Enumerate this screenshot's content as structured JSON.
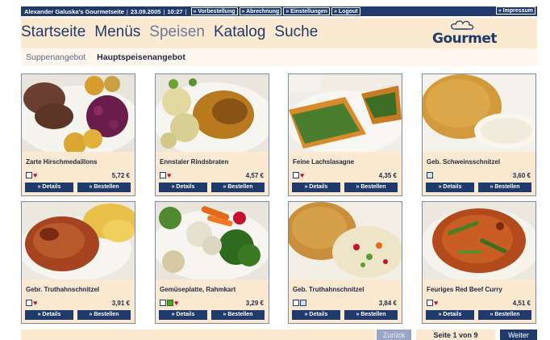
{
  "topbar": {
    "site_title": "Alexander Galuska's Gourmetseite",
    "date": "23.09.2005",
    "time": "10:27",
    "links": [
      "» Vorbestellung",
      "» Abrechnung",
      "» Einstellungen",
      "» Logout"
    ],
    "impressum": "» Impressum"
  },
  "nav": {
    "items": [
      "Startseite",
      "Menüs",
      "Speisen",
      "Katalog",
      "Suche"
    ],
    "active": "Speisen"
  },
  "logo": {
    "text": "Gourmet"
  },
  "subnav": {
    "items": [
      "Suppenangebot",
      "Hauptspeisenangebot"
    ],
    "active": "Hauptspeisenangebot"
  },
  "buttons": {
    "details": "» Details",
    "order": "» Bestellen"
  },
  "dishes": [
    {
      "name": "Zarte Hirschmedaillons",
      "price": "5,72 €",
      "icons": [
        "box",
        "heart"
      ]
    },
    {
      "name": "Ennstaler Rindsbraten",
      "price": "4,57 €",
      "icons": [
        "box",
        "heart"
      ]
    },
    {
      "name": "Feine Lachslasagne",
      "price": "4,35 €",
      "icons": [
        "box",
        "heart"
      ]
    },
    {
      "name": "Geb. Schweinsschnitzel",
      "price": "3,60 €",
      "icons": [
        "blue"
      ]
    },
    {
      "name": "Gebr. Truthahnschnitzel",
      "price": "3,91 €",
      "icons": [
        "box",
        "heart"
      ]
    },
    {
      "name": "Gemüseplatte, Rahmkart",
      "price": "3,29 €",
      "icons": [
        "box",
        "leaf",
        "heart"
      ]
    },
    {
      "name": "Geb. Truthahnschnitzel",
      "price": "3,84 €",
      "icons": [
        "box",
        "blue"
      ]
    },
    {
      "name": "Feuriges Red Beef Curry",
      "price": "4,51 €",
      "icons": [
        "box",
        "heart"
      ]
    }
  ],
  "pagination": {
    "back": "Zurück",
    "page": "Seite 1 von 9",
    "next": "Weiter"
  },
  "colors": {
    "navy": "#1f3a6b",
    "peach": "#fce9d1",
    "heart": "#c8102e"
  }
}
